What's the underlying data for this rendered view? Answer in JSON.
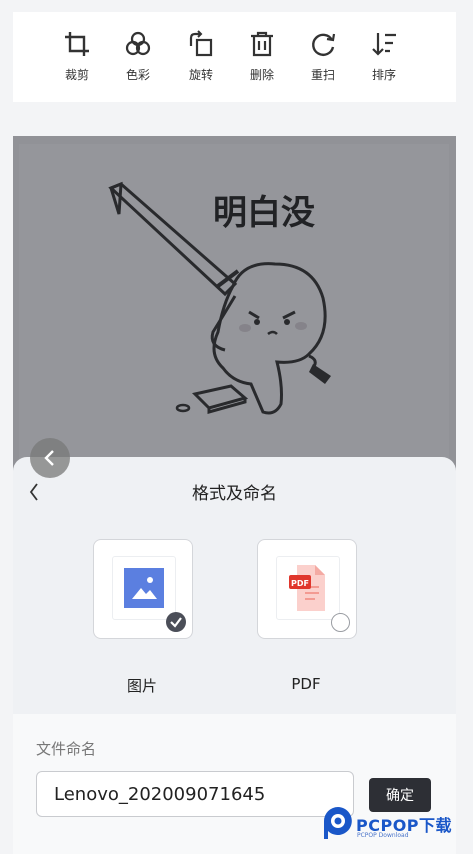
{
  "toolbar": {
    "items": [
      {
        "label": "裁剪",
        "icon": "crop-icon"
      },
      {
        "label": "色彩",
        "icon": "color-icon"
      },
      {
        "label": "旋转",
        "icon": "rotate-icon"
      },
      {
        "label": "删除",
        "icon": "delete-icon"
      },
      {
        "label": "重扫",
        "icon": "rescan-icon"
      },
      {
        "label": "排序",
        "icon": "sort-icon"
      }
    ]
  },
  "photo": {
    "caption_text": "明白没"
  },
  "sheet": {
    "title": "格式及命名",
    "formats": [
      {
        "label": "图片",
        "icon": "image-file-icon",
        "selected": true
      },
      {
        "label": "PDF",
        "icon": "pdf-file-icon",
        "selected": false
      }
    ],
    "name_label": "文件命名",
    "name_value": "Lenovo_202009071645",
    "confirm_label": "确定"
  },
  "watermark": {
    "brand": "PCPOP下载",
    "sub": "PCPOP Download"
  },
  "colors": {
    "accent_dark": "#2d2f35",
    "image_icon_blue": "#5b7fe0",
    "pdf_red": "#e0362c",
    "watermark_blue": "#1a57c8"
  }
}
